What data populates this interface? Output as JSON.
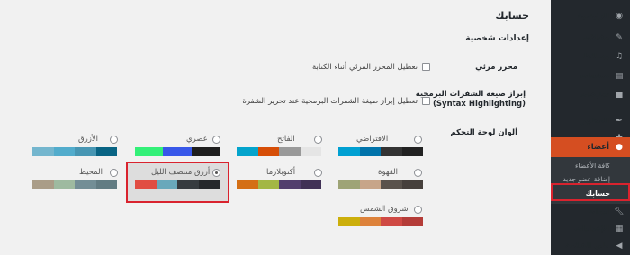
{
  "page": {
    "title": "حسابك",
    "section_personal": "إعدادات شخصية"
  },
  "editor": {
    "label": "محرر مرئي",
    "checkbox_text": "تعطيل المحرر المرئي أثناء الكتابة"
  },
  "syntax": {
    "label_line1": "إبراز صيغة الشفرات البرمجية",
    "label_line2": "(Syntax Highlighting)",
    "checkbox_text": "تعطيل إبراز صيغة الشفرات البرمجية عند تحرير الشفرة"
  },
  "colors_label": "ألوان لوحة التحكم",
  "schemes": [
    {
      "name": "الافتراضي",
      "checked": false,
      "colors": [
        "#222222",
        "#333333",
        "#0073aa",
        "#00a0d2"
      ]
    },
    {
      "name": "الفاتح",
      "checked": false,
      "colors": [
        "#e5e5e5",
        "#999999",
        "#d64e07",
        "#04a4cc"
      ]
    },
    {
      "name": "عصري",
      "checked": false,
      "colors": [
        "#1e1e1e",
        "#3858e9",
        "#33f078"
      ]
    },
    {
      "name": "الأزرق",
      "checked": false,
      "colors": [
        "#096484",
        "#4796b3",
        "#52accc",
        "#74b6ce"
      ]
    },
    {
      "name": "القهوة",
      "checked": false,
      "colors": [
        "#46403c",
        "#59524c",
        "#c7a589",
        "#9ea476"
      ]
    },
    {
      "name": "أكتوبلازما",
      "checked": false,
      "colors": [
        "#413256",
        "#523f6d",
        "#a3b745",
        "#d46f15"
      ]
    },
    {
      "name": "أزرق منتصف الليل",
      "checked": true,
      "colors": [
        "#25282b",
        "#363b3f",
        "#69a8bb",
        "#e14d43"
      ]
    },
    {
      "name": "المحيط",
      "checked": false,
      "colors": [
        "#627c83",
        "#738e96",
        "#9ebaa0",
        "#aa9d88"
      ]
    },
    {
      "name": "شروق الشمس",
      "checked": false,
      "colors": [
        "#b43c38",
        "#cf4944",
        "#dd823b",
        "#ccaf0b"
      ]
    }
  ],
  "sidebar": {
    "items": [
      {
        "label": "الرئيسية",
        "icon": "dashboard-icon"
      },
      {
        "label": "مقالات",
        "icon": "pin-icon"
      },
      {
        "label": "وسائط",
        "icon": "media-icon"
      },
      {
        "label": "صفحات",
        "icon": "pages-icon"
      },
      {
        "label": "تعليقات",
        "icon": "comment-icon"
      },
      {
        "label": "المظهر",
        "icon": "brush-icon"
      },
      {
        "label": "إضافات",
        "icon": "plugin-icon"
      },
      {
        "label": "أعضاء",
        "icon": "users-icon"
      },
      {
        "label": "أدوات",
        "icon": "wrench-icon"
      },
      {
        "label": "الإعدادات",
        "icon": "settings-icon"
      },
      {
        "label": "طي القائمة",
        "icon": "collapse-icon"
      }
    ],
    "submenu": [
      "كافة الأعضاء",
      "إضافة عضو جديد",
      "حسابك"
    ]
  }
}
